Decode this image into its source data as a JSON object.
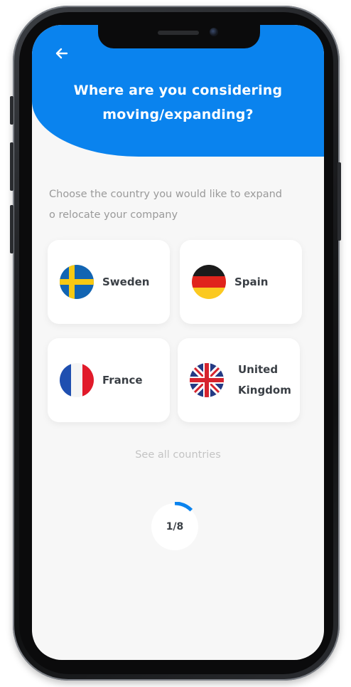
{
  "header": {
    "back_icon": "arrow-left-icon",
    "title_line1": "Where are you considering",
    "title_line2": "moving/expanding?",
    "accent_color": "#0a83ee"
  },
  "main": {
    "subtitle_line1": "Choose the country you would like to expand",
    "subtitle_line2": "o relocate your company",
    "countries": [
      {
        "name": "Sweden",
        "flag_icon": "sweden-flag-icon"
      },
      {
        "name": "Spain",
        "flag_icon": "germany-flag-icon"
      },
      {
        "name": "France",
        "flag_icon": "france-flag-icon"
      },
      {
        "name_line1": "United",
        "name_line2": "Kingdom",
        "flag_icon": "uk-flag-icon"
      }
    ],
    "see_all_label": "See all countries"
  },
  "progress": {
    "label": "1/8",
    "current": 1,
    "total": 8,
    "color": "#0a83ee"
  }
}
